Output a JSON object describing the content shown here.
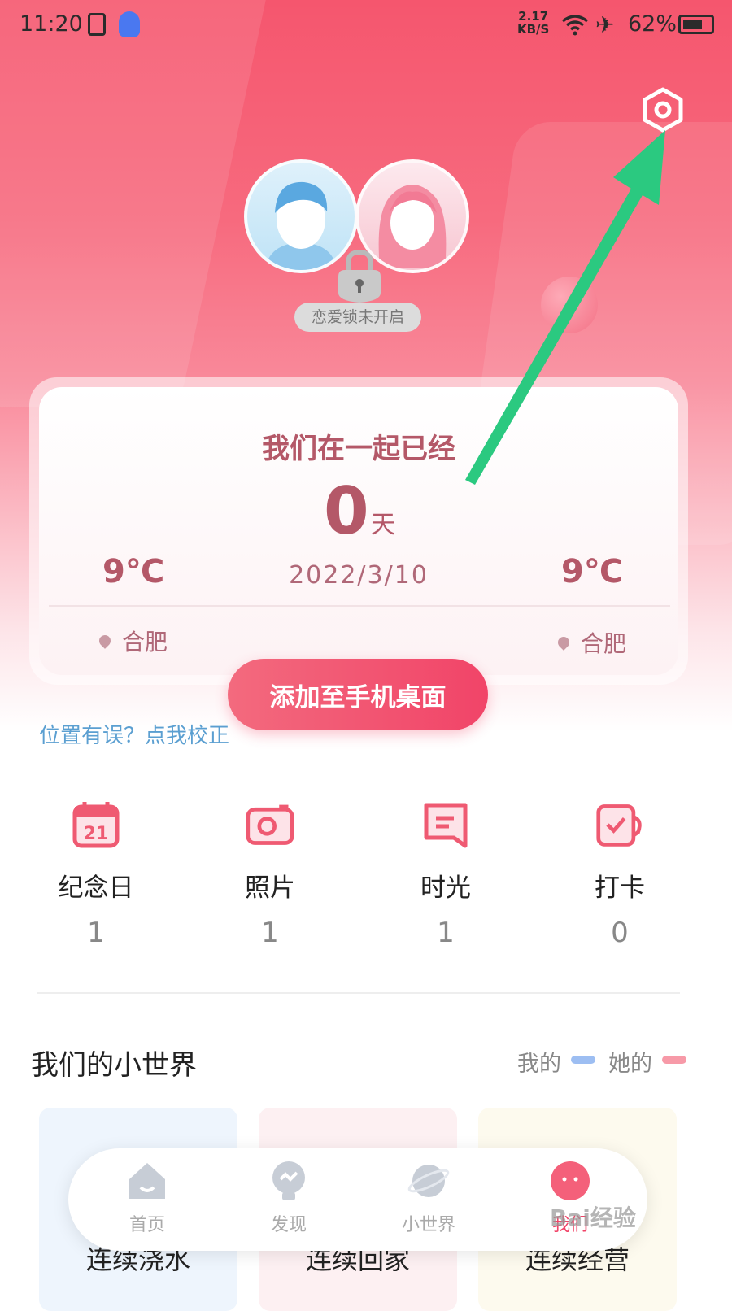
{
  "status_bar": {
    "time": "11:20",
    "speed_value": "2.17",
    "speed_unit": "KB/S",
    "battery": "62%"
  },
  "couple": {
    "lock_text": "恋爱锁未开启"
  },
  "card": {
    "title": "我们在一起已经",
    "days": "0",
    "days_unit": "天",
    "date": "2022/3/10",
    "left": {
      "temp": "9℃",
      "city": "合肥"
    },
    "right": {
      "temp": "9℃",
      "city": "合肥"
    }
  },
  "add_button": "添加至手机桌面",
  "fix_location": "位置有误？点我校正",
  "stats": [
    {
      "label": "纪念日",
      "count": "1",
      "icon": "calendar-icon"
    },
    {
      "label": "照片",
      "count": "1",
      "icon": "camera-icon"
    },
    {
      "label": "时光",
      "count": "1",
      "icon": "bookmark-icon"
    },
    {
      "label": "打卡",
      "count": "0",
      "icon": "checkin-icon"
    }
  ],
  "world": {
    "title": "我们的小世界",
    "legend_mine": "我的",
    "legend_hers": "她的",
    "cards": [
      "连续浇水",
      "连续回家",
      "连续经营"
    ]
  },
  "tabs": [
    {
      "label": "首页",
      "icon": "home-icon"
    },
    {
      "label": "发现",
      "icon": "discover-icon"
    },
    {
      "label": "小世界",
      "icon": "planet-icon"
    },
    {
      "label": "我们",
      "icon": "us-icon"
    }
  ],
  "watermark": "Bai经验",
  "colors": {
    "accent": "#f14468",
    "card_text": "#b45868",
    "link": "#5b9fd1",
    "annotation_arrow": "#2bc980"
  }
}
